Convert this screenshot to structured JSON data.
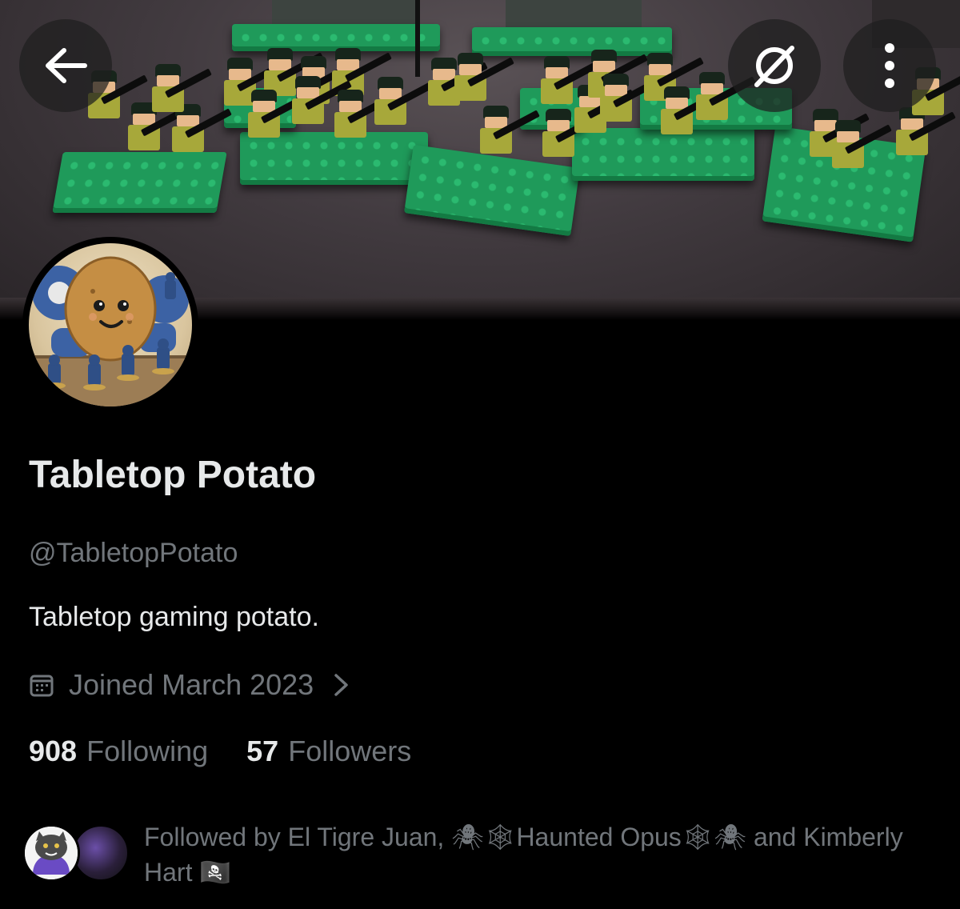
{
  "header": {
    "back_icon": "arrow-left-icon",
    "grok_icon": "grok-icon",
    "more_icon": "more-vertical-icon"
  },
  "profile": {
    "display_name": "Tabletop Potato",
    "handle": "@TabletopPotato",
    "bio": "Tabletop gaming potato.",
    "joined_icon": "calendar-icon",
    "joined": "Joined March 2023",
    "joined_chevron_icon": "chevron-right-icon"
  },
  "stats": {
    "following_count": "908",
    "following_label": "Following",
    "followers_count": "57",
    "followers_label": "Followers"
  },
  "followed_by": {
    "text": "Followed by El Tigre Juan, 🕷🕸Haunted Opus🕸🕷 and Kimberly Hart 🏴‍☠️"
  },
  "colors": {
    "background": "#000000",
    "primary_text": "#e7e9ea",
    "secondary_text": "#71767b"
  }
}
